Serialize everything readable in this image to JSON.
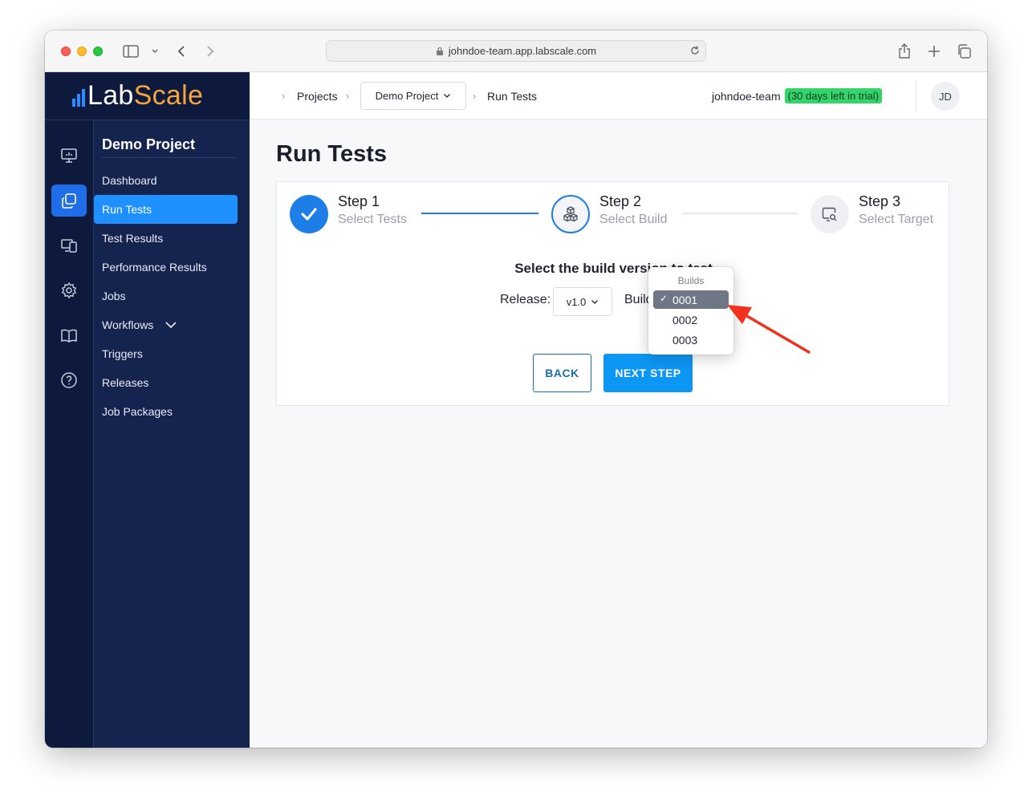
{
  "browser": {
    "url": "johndoe-team.app.labscale.com"
  },
  "logo": {
    "text_main": "Lab",
    "text_accent": "Scale"
  },
  "rail": {
    "items": [
      "presentation-icon",
      "copy-icon",
      "devices-icon",
      "gear-icon",
      "book-icon",
      "help-icon"
    ]
  },
  "sidenav": {
    "project_title": "Demo Project",
    "items": [
      {
        "label": "Dashboard"
      },
      {
        "label": "Run Tests"
      },
      {
        "label": "Test Results"
      },
      {
        "label": "Performance Results"
      },
      {
        "label": "Jobs"
      },
      {
        "label": "Workflows"
      },
      {
        "label": "Triggers"
      },
      {
        "label": "Releases"
      },
      {
        "label": "Job Packages"
      }
    ]
  },
  "topbar": {
    "crumb_projects": "Projects",
    "crumb_project": "Demo Project",
    "crumb_current": "Run Tests",
    "team": "johndoe-team",
    "trial": "(30 days left in trial)",
    "avatar": "JD"
  },
  "page": {
    "title": "Run Tests",
    "steps": [
      {
        "title": "Step 1",
        "subtitle": "Select Tests"
      },
      {
        "title": "Step 2",
        "subtitle": "Select Build"
      },
      {
        "title": "Step 3",
        "subtitle": "Select Target"
      }
    ],
    "prompt": "Select the build version to test",
    "release_label": "Release:",
    "release_value": "v1.0",
    "build_label": "Build:",
    "back": "BACK",
    "next": "NEXT STEP"
  },
  "builds_popup": {
    "header": "Builds",
    "options": [
      "0001",
      "0002",
      "0003"
    ],
    "selected": "0001"
  },
  "colors": {
    "accent": "#1e90ff",
    "sidebar": "#15234f",
    "rail": "#0e1a3d",
    "trial_badge": "#34d46a",
    "annotation_arrow": "#f0321e"
  }
}
